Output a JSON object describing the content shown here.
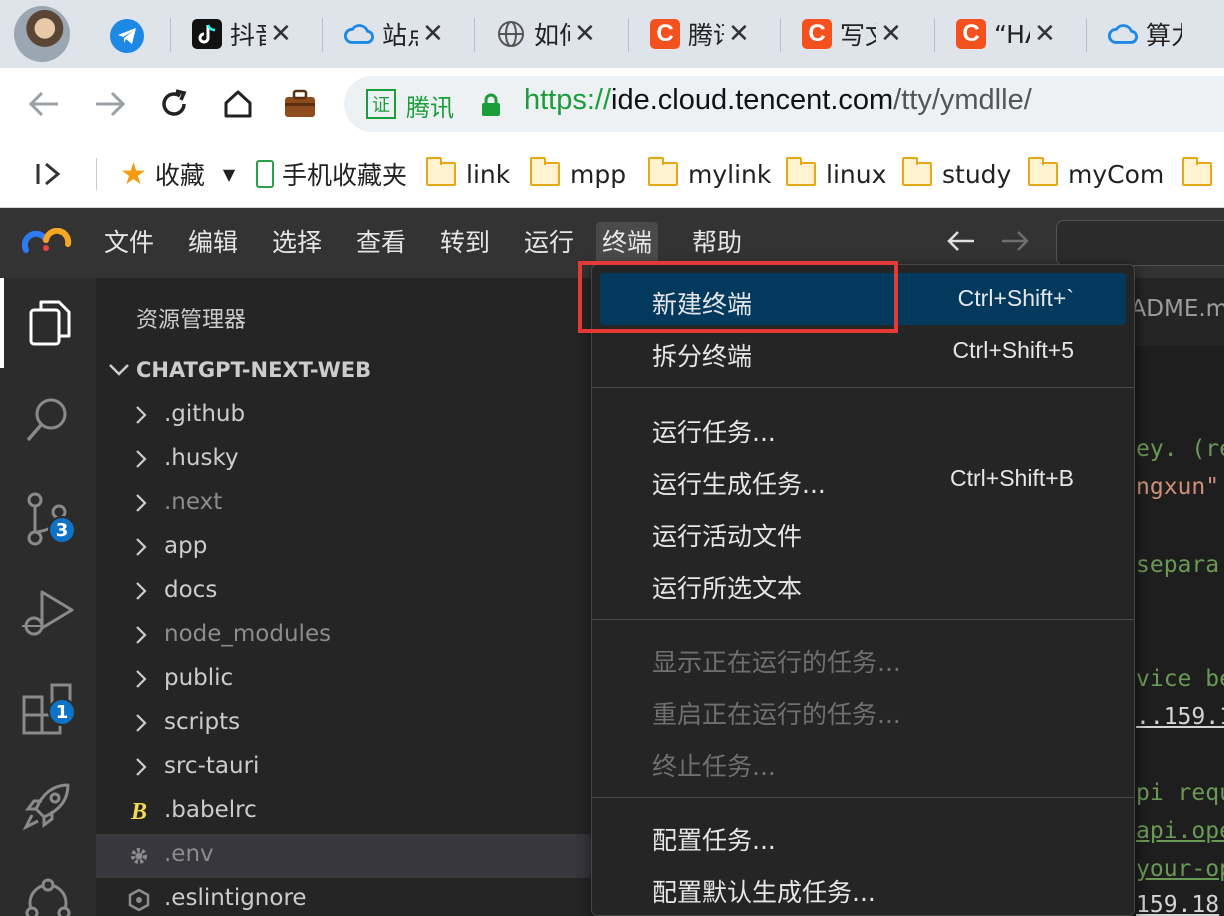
{
  "browser": {
    "tabs": [
      {
        "title": "抖音",
        "icon": "tiktok-icon"
      },
      {
        "title": "站点",
        "icon": "cloud-icon"
      },
      {
        "title": "如何",
        "icon": "globe-icon"
      },
      {
        "title": "腾讯",
        "icon": "csdn-icon"
      },
      {
        "title": "写文",
        "icon": "csdn-icon"
      },
      {
        "title": "“HA",
        "icon": "csdn-icon"
      },
      {
        "title": "算力",
        "icon": "cloud-icon"
      }
    ],
    "tab_icon_letter": "C",
    "tab_close": "✕",
    "address": {
      "cert_badge": "证",
      "cert_name": "腾讯",
      "scheme": "https://",
      "host": "ide.cloud.tencent.com",
      "path": "/tty/ymdlle/"
    },
    "bookmarks": {
      "favorites_label": "收藏",
      "mobile_label": "手机收藏夹",
      "folders": [
        "link",
        "mpp",
        "mylink",
        "linux",
        "study",
        "myCom"
      ]
    }
  },
  "ide": {
    "menu": [
      "文件",
      "编辑",
      "选择",
      "查看",
      "转到",
      "运行",
      "终端",
      "帮助"
    ],
    "active_menu": "终端",
    "badges": {
      "source_control": "3",
      "extensions": "1"
    },
    "explorer": {
      "title": "资源管理器",
      "section": "CHATGPT-NEXT-WEB",
      "items": [
        {
          "name": ".github",
          "type": "folder",
          "dim": false
        },
        {
          "name": ".husky",
          "type": "folder",
          "dim": false
        },
        {
          "name": ".next",
          "type": "folder",
          "dim": true
        },
        {
          "name": "app",
          "type": "folder",
          "dim": false
        },
        {
          "name": "docs",
          "type": "folder",
          "dim": false
        },
        {
          "name": "node_modules",
          "type": "folder",
          "dim": true
        },
        {
          "name": "public",
          "type": "folder",
          "dim": false
        },
        {
          "name": "scripts",
          "type": "folder",
          "dim": false
        },
        {
          "name": "src-tauri",
          "type": "folder",
          "dim": false
        },
        {
          "name": ".babelrc",
          "type": "babel",
          "dim": false
        },
        {
          "name": ".env",
          "type": "settings",
          "dim": true,
          "selected": true
        },
        {
          "name": ".eslintignore",
          "type": "eslint",
          "dim": false
        }
      ]
    },
    "editor": {
      "tab_label": "EADME.m",
      "code_fragments": [
        "ey. (re",
        "ngxun\"",
        "separa",
        "vice be",
        "..159.1",
        "pi requ",
        "api.ope",
        "your-op",
        "159.18"
      ]
    },
    "terminal_menu": {
      "groups": [
        [
          {
            "label": "新建终端",
            "shortcut": "Ctrl+Shift+`",
            "hover": true
          },
          {
            "label": "拆分终端",
            "shortcut": "Ctrl+Shift+5"
          }
        ],
        [
          {
            "label": "运行任务...",
            "shortcut": ""
          },
          {
            "label": "运行生成任务...",
            "shortcut": "Ctrl+Shift+B"
          },
          {
            "label": "运行活动文件",
            "shortcut": ""
          },
          {
            "label": "运行所选文本",
            "shortcut": ""
          }
        ],
        [
          {
            "label": "显示正在运行的任务...",
            "shortcut": "",
            "disabled": true
          },
          {
            "label": "重启正在运行的任务...",
            "shortcut": "",
            "disabled": true
          },
          {
            "label": "终止任务...",
            "shortcut": "",
            "disabled": true
          }
        ],
        [
          {
            "label": "配置任务...",
            "shortcut": ""
          },
          {
            "label": "配置默认生成任务...",
            "shortcut": ""
          }
        ]
      ]
    }
  },
  "colors": {
    "accent_highlight": "#e53935",
    "menu_hover": "#04395e",
    "badge": "#0e72c6",
    "secure_green": "#1a9e3a"
  }
}
